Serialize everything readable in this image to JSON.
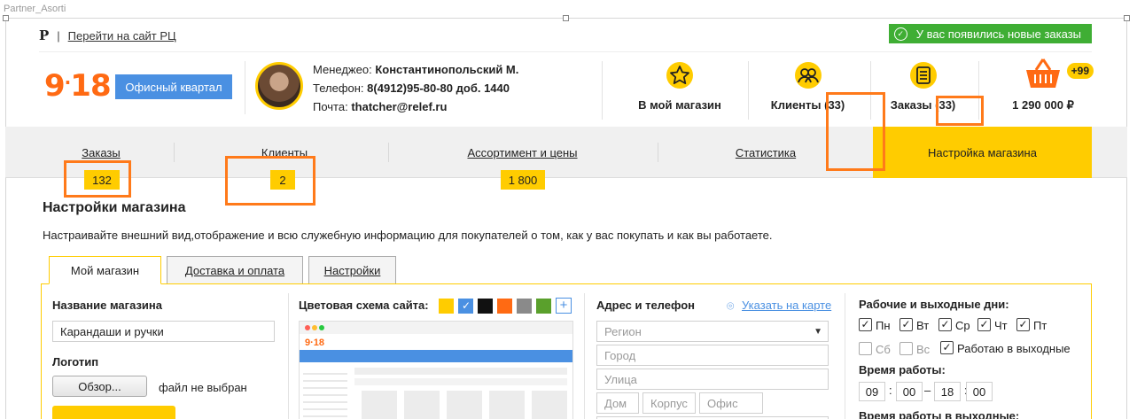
{
  "canvas": {
    "artboard_name": "Partner_Asorti"
  },
  "topbar": {
    "logo_letter": "Р",
    "separator": "|",
    "link_label": "Перейти на сайт РЦ",
    "notification": "У вас появились новые заказы"
  },
  "header": {
    "logo": {
      "big": "9",
      "dot": "·",
      "small": "18"
    },
    "office_button": "Офисный квартал",
    "manager": {
      "manager_label": "Менеджео:",
      "manager_name": "Константинопольский М.",
      "phone_label": "Телефон:",
      "phone_value": "8(4912)95-80-80 доб. 1440",
      "mail_label": "Почта:",
      "mail_value": "thatcher@relef.ru"
    },
    "actions": [
      {
        "label": "В мой магазин",
        "icon": "star-icon"
      },
      {
        "label": "Клиенты (33)",
        "icon": "clients-icon"
      },
      {
        "label": "Заказы (33)",
        "icon": "orders-list-icon"
      },
      {
        "label": "1 290 000 ₽",
        "icon": "basket-icon",
        "badge": "+99"
      }
    ]
  },
  "nav": {
    "items": [
      {
        "label": "Заказы",
        "count": "132"
      },
      {
        "label": "Клиенты",
        "count": "2"
      },
      {
        "label": "Ассортимент и цены",
        "count": "1 800"
      },
      {
        "label": "Статистика"
      },
      {
        "label": "Настройка магазина",
        "active": true
      }
    ]
  },
  "page": {
    "title": "Настройки магазина",
    "description": "Настраивайте внешний вид,отображение и всю служебную информацию для покупателей о том, как у вас покупать и как вы работаете."
  },
  "tabs": [
    {
      "label": "Мой магазин",
      "active": true
    },
    {
      "label": "Доставка и оплата"
    },
    {
      "label": "Настройки"
    }
  ],
  "store_form": {
    "name_label": "Название магазина",
    "name_value": "Карандаши и ручки",
    "logo_label": "Логотип",
    "browse_button": "Обзор...",
    "file_status": "файл не выбран"
  },
  "color_scheme": {
    "label": "Цветовая схема сайта:",
    "colors": [
      "#ffcc00",
      "#4a90e2",
      "#111111",
      "#ff6a13",
      "#8a8a8a",
      "#5aa02c"
    ],
    "selected_index": 1,
    "add_label": "+"
  },
  "address": {
    "label": "Адрес и телефон",
    "map_link": "Указать на карте",
    "region_placeholder": "Регион",
    "city_placeholder": "Город",
    "street_placeholder": "Улица",
    "house_placeholder": "Дом",
    "building_placeholder": "Корпус",
    "office_placeholder": "Офис"
  },
  "schedule": {
    "label": "Рабочие и выходные дни:",
    "days": [
      {
        "label": "Пн",
        "checked": true
      },
      {
        "label": "Вт",
        "checked": true
      },
      {
        "label": "Ср",
        "checked": true
      },
      {
        "label": "Чт",
        "checked": true
      },
      {
        "label": "Пт",
        "checked": true
      },
      {
        "label": "Сб",
        "checked": false
      },
      {
        "label": "Вс",
        "checked": false
      }
    ],
    "weekend_label": "Работаю в выходные",
    "weekend_checked": true,
    "time_label": "Время работы:",
    "from_h": "09",
    "from_m": "00",
    "to_h": "18",
    "to_m": "00",
    "colon": ":",
    "dash": "–",
    "weekend_time_label": "Время работы в выходные:"
  }
}
